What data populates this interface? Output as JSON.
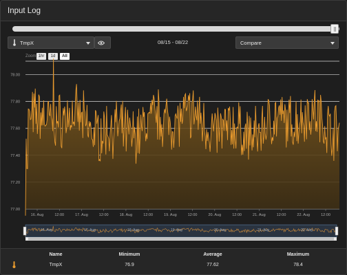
{
  "window": {
    "title": "Input Log"
  },
  "toolbar": {
    "channel_label": "TmpX",
    "channel_icon": "thermometer-icon",
    "visibility_icon": "eye-icon",
    "date_range": "08/15 - 08/22",
    "compare_label": "Compare"
  },
  "zoom": {
    "label": "Zoom",
    "options": [
      "1hr",
      "1d",
      "All"
    ],
    "active": "All"
  },
  "colors": {
    "series": "#e89a2e",
    "background": "#1e1e1e",
    "grid": "#d8d8d8",
    "navigator": "#5a7fa6"
  },
  "chart_data": {
    "type": "area",
    "x_ticks": [
      "16. Aug",
      "12:00",
      "17. Aug",
      "12:00",
      "18. Aug",
      "12:00",
      "19. Aug",
      "12:00",
      "20. Aug",
      "12:00",
      "21. Aug",
      "12:00",
      "22. Aug",
      "12:00"
    ],
    "navigator_ticks": [
      "16. Aug",
      "17. Aug",
      "18. Aug",
      "19. Aug",
      "20. Aug",
      "21. Aug",
      "22. Aug"
    ],
    "y_ticks": [
      "77.00",
      "77.20",
      "77.40",
      "77.60",
      "77.80",
      "78.00"
    ],
    "ylim": [
      77.0,
      78.1
    ],
    "grid": true,
    "series": [
      {
        "name": "TmpX",
        "min": 76.9,
        "avg": 77.62,
        "max": 78.4
      }
    ]
  },
  "summary": {
    "headers": {
      "name": "Name",
      "min": "Minimum",
      "avg": "Average",
      "max": "Maximum"
    },
    "rows": [
      {
        "icon": "thermometer-icon",
        "name": "TmpX",
        "min": "76.9",
        "avg": "77.62",
        "max": "78.4"
      }
    ]
  }
}
